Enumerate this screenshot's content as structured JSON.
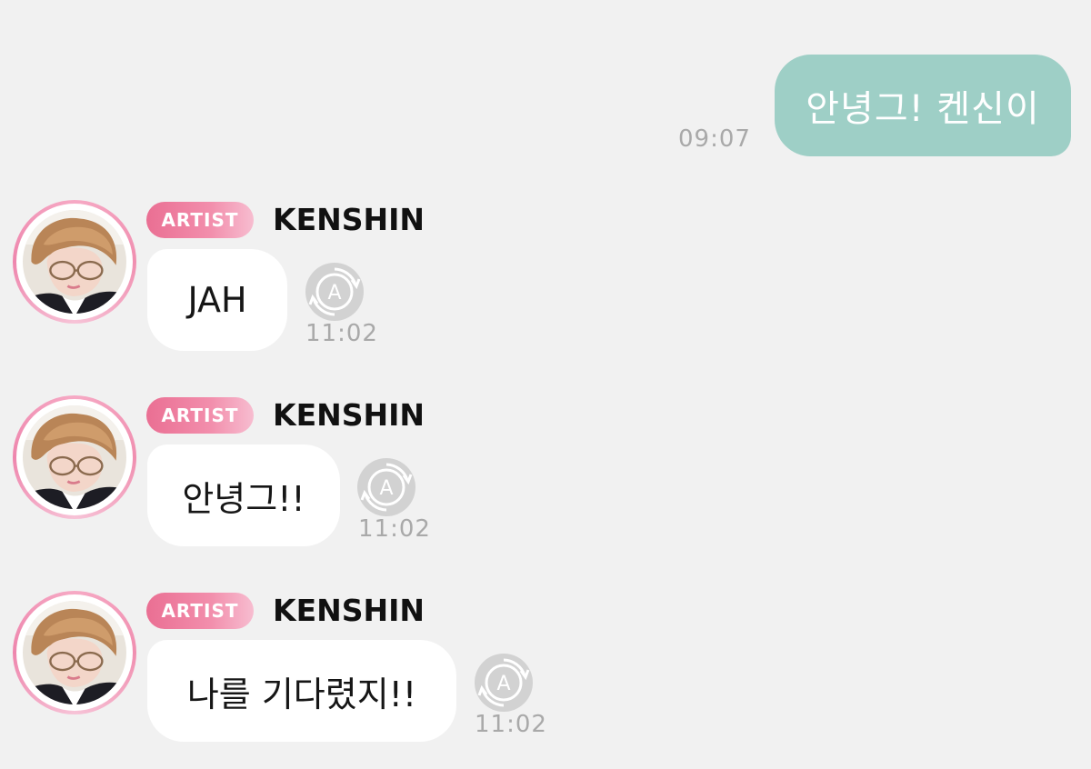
{
  "outgoing": {
    "text": "안녕그! 켄신이",
    "time": "09:07"
  },
  "incoming": [
    {
      "badge": "ARTIST",
      "sender": "KENSHIN",
      "text": "JAH",
      "time": "11:02",
      "translate_icon": "auto-translate-icon"
    },
    {
      "badge": "ARTIST",
      "sender": "KENSHIN",
      "text": "안녕그!!",
      "time": "11:02",
      "translate_icon": "auto-translate-icon"
    },
    {
      "badge": "ARTIST",
      "sender": "KENSHIN",
      "text": "나를 기다렸지!!",
      "time": "11:02",
      "translate_icon": "auto-translate-icon"
    }
  ],
  "colors": {
    "background": "#f1f1f1",
    "outgoing_bubble": "#9ecfc6",
    "incoming_bubble": "#ffffff",
    "artist_badge": "#ea6f93",
    "timestamp": "#a9a9a9"
  }
}
